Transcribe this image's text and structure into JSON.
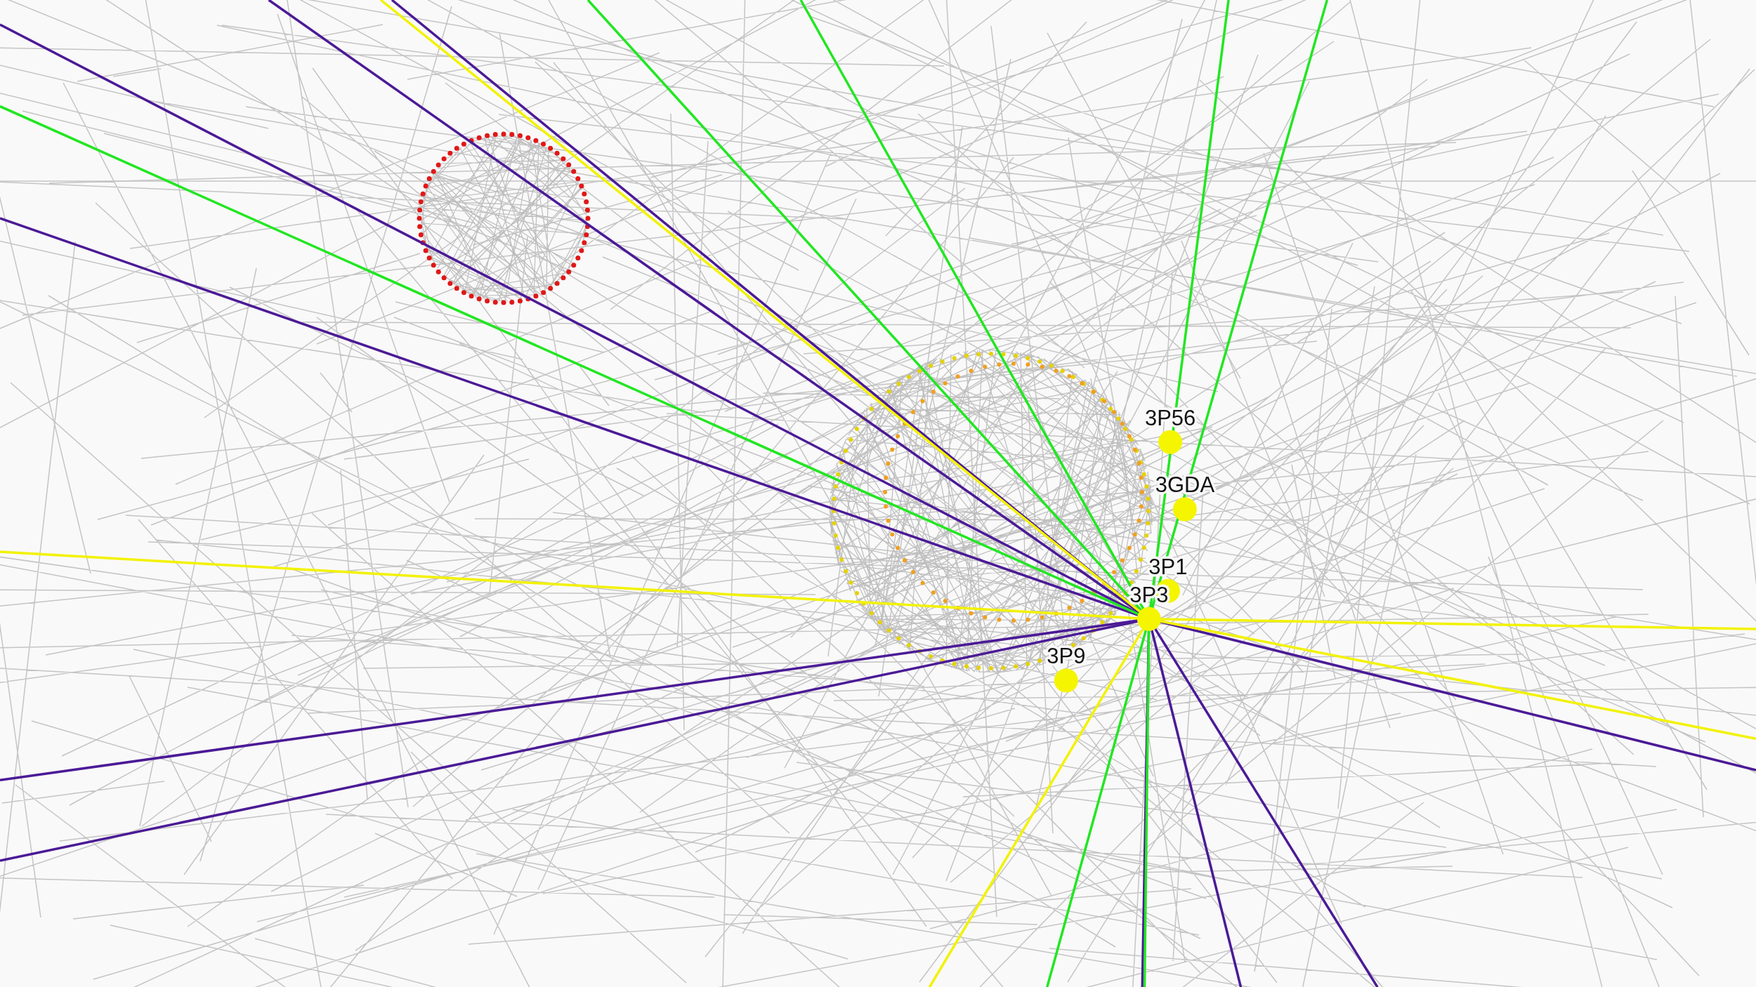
{
  "graph": {
    "nodes": [
      {
        "label": "3P56"
      },
      {
        "label": "3GDA"
      },
      {
        "label": "3P1"
      },
      {
        "label": "3P3"
      },
      {
        "label": "3P9"
      }
    ]
  }
}
